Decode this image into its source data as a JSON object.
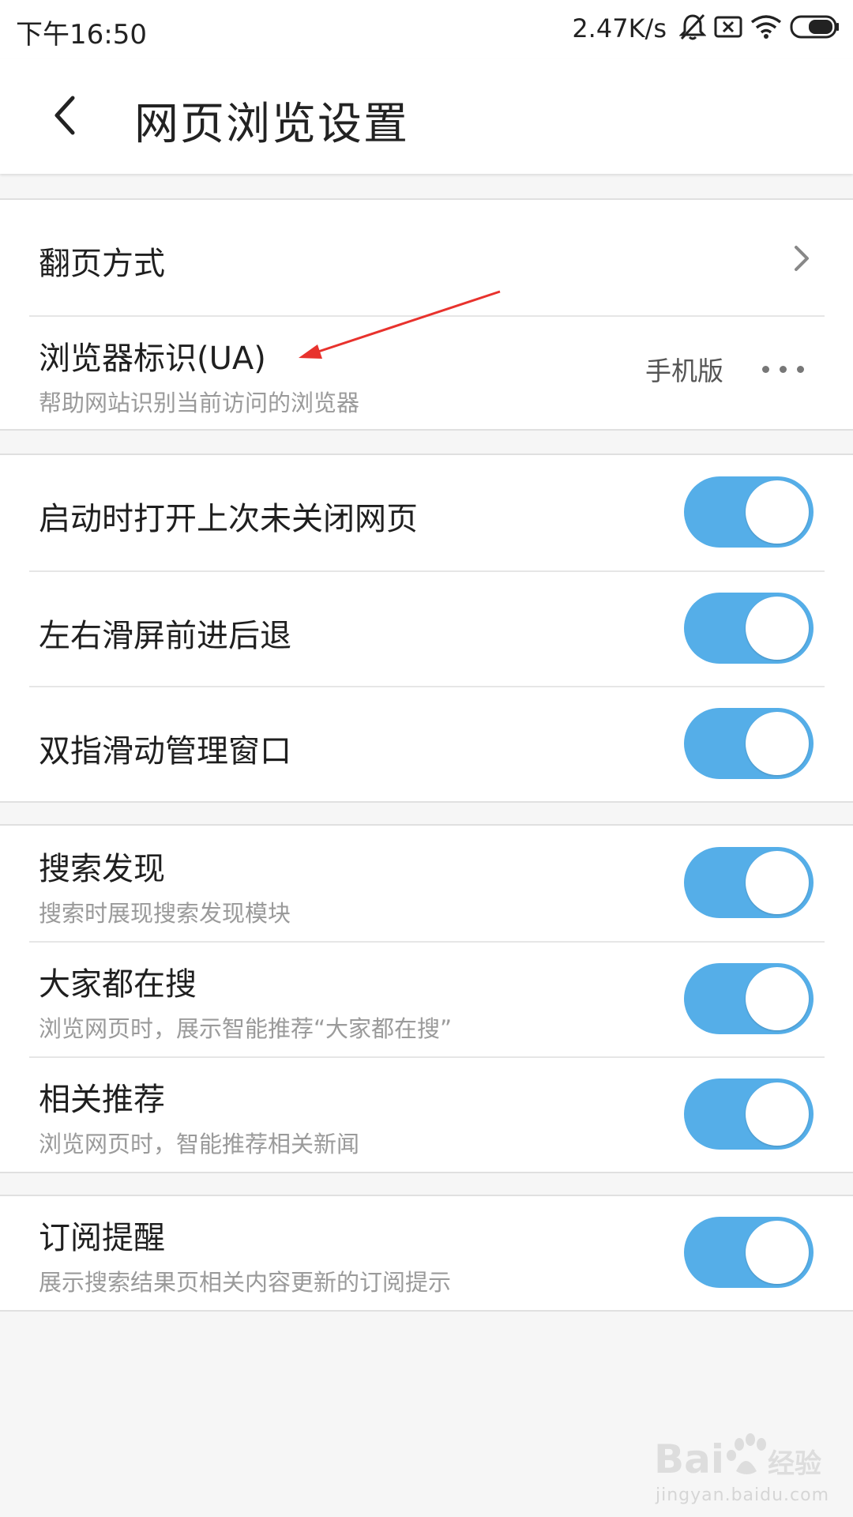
{
  "status_bar": {
    "time": "下午16:50",
    "network_speed": "2.47K/s",
    "icons": [
      "bell-off-icon",
      "sim-x-icon",
      "wifi-icon",
      "battery-icon"
    ]
  },
  "header": {
    "back_icon": "chevron-left-icon",
    "title": "网页浏览设置"
  },
  "groups": [
    {
      "rows": [
        {
          "label": "翻页方式",
          "control": "chevron-right-icon"
        },
        {
          "label": "浏览器标识(UA)",
          "description": "帮助网站识别当前访问的浏览器",
          "value": "手机版",
          "control": "more-dots-icon"
        }
      ]
    },
    {
      "rows": [
        {
          "label": "启动时打开上次未关闭网页",
          "toggle_on": true
        },
        {
          "label": "左右滑屏前进后退",
          "toggle_on": true
        },
        {
          "label": "双指滑动管理窗口",
          "toggle_on": true
        }
      ]
    },
    {
      "rows": [
        {
          "label": "搜索发现",
          "description": "搜索时展现搜索发现模块",
          "toggle_on": true
        },
        {
          "label": "大家都在搜",
          "description": "浏览网页时，展示智能推荐“大家都在搜”",
          "toggle_on": true
        },
        {
          "label": "相关推荐",
          "description": "浏览网页时，智能推荐相关新闻",
          "toggle_on": true
        }
      ]
    },
    {
      "rows": [
        {
          "label": "订阅提醒",
          "description": "展示搜索结果页相关内容更新的订阅提示",
          "toggle_on": true
        }
      ]
    }
  ],
  "annotation": {
    "arrow_color": "#e8322d"
  },
  "watermark": {
    "brand": "Bai",
    "brand_end": "du",
    "cn": "经验",
    "url": "jingyan.baidu.com"
  },
  "colors": {
    "toggle_on": "#55aee8",
    "background": "#f6f6f6"
  }
}
